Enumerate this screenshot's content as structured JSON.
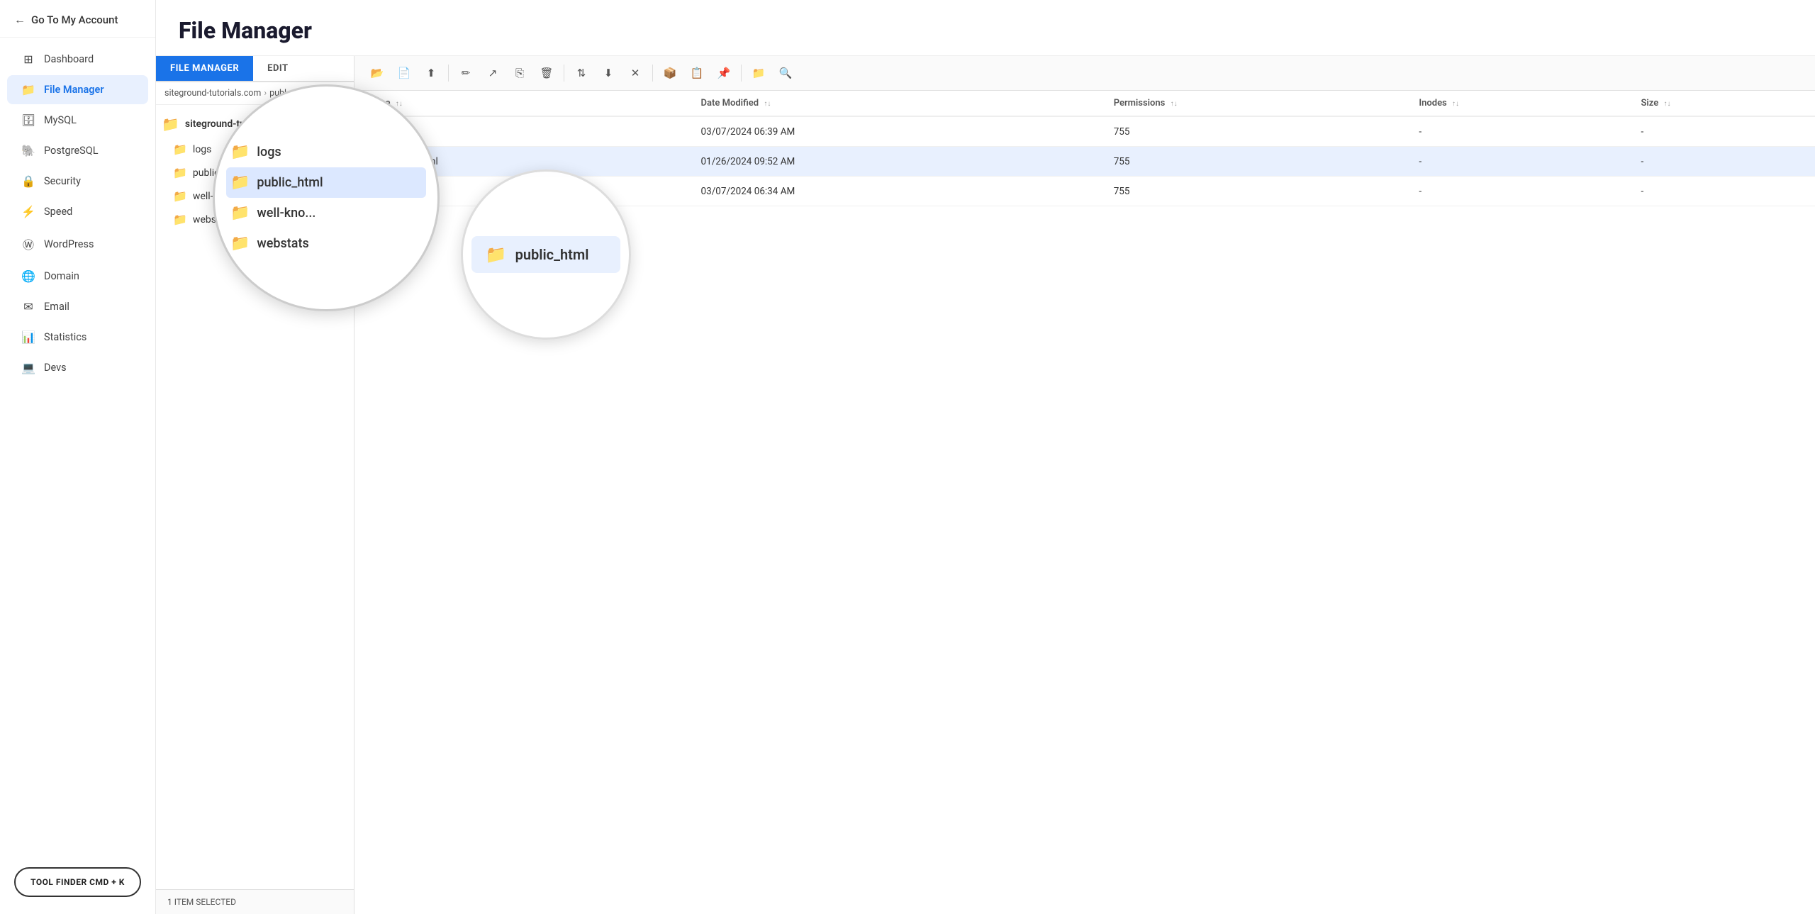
{
  "sidebar": {
    "back_label": "Go To My Account",
    "nav_items": [
      {
        "id": "dashboard",
        "label": "Dashboard",
        "icon": "⊞"
      },
      {
        "id": "file-manager",
        "label": "File Manager",
        "icon": "📁",
        "active": true
      },
      {
        "id": "mysql",
        "label": "MySQL",
        "icon": "🗄"
      },
      {
        "id": "postgresql",
        "label": "PostgreSQL",
        "icon": "🐘"
      },
      {
        "id": "security",
        "label": "Security",
        "icon": "🔒"
      },
      {
        "id": "speed",
        "label": "Speed",
        "icon": "⚡"
      },
      {
        "id": "wordpress",
        "label": "WordPress",
        "icon": "Ⓦ"
      },
      {
        "id": "domain",
        "label": "Domain",
        "icon": "🌐"
      },
      {
        "id": "email",
        "label": "Email",
        "icon": "✉"
      },
      {
        "id": "statistics",
        "label": "Statistics",
        "icon": "📊"
      },
      {
        "id": "devs",
        "label": "Devs",
        "icon": "💻"
      }
    ],
    "tool_finder_label": "TOOL FINDER CMD + K"
  },
  "page": {
    "title": "File Manager"
  },
  "tabs": [
    {
      "id": "file-manager-tab",
      "label": "FILE MANAGER",
      "active": true
    },
    {
      "id": "edit-tab",
      "label": "EDIT",
      "active": false
    }
  ],
  "breadcrumb": {
    "parts": [
      "siteground-tutorials.com",
      "publ..."
    ]
  },
  "folder_tree": {
    "root": "siteground-tutorials.com",
    "children": [
      {
        "name": "logs",
        "has_children": false
      },
      {
        "name": "public_html",
        "has_children": true,
        "expanded": true
      },
      {
        "name": "well-know...",
        "has_children": false
      },
      {
        "name": "webstats",
        "has_children": false
      }
    ]
  },
  "toolbar_buttons": [
    {
      "id": "new-folder",
      "icon": "📂",
      "tooltip": "New Folder"
    },
    {
      "id": "new-file",
      "icon": "📄",
      "tooltip": "New File"
    },
    {
      "id": "upload",
      "icon": "⬆",
      "tooltip": "Upload"
    },
    {
      "id": "edit-file",
      "icon": "✏",
      "tooltip": "Edit"
    },
    {
      "id": "move",
      "icon": "↗",
      "tooltip": "Move"
    },
    {
      "id": "copy",
      "icon": "⎘",
      "tooltip": "Copy"
    },
    {
      "id": "delete",
      "icon": "🗑",
      "tooltip": "Delete"
    },
    {
      "id": "move2",
      "icon": "⇕",
      "tooltip": "Move"
    },
    {
      "id": "download",
      "icon": "⬇",
      "tooltip": "Download"
    },
    {
      "id": "delete2",
      "icon": "✕",
      "tooltip": "Delete"
    },
    {
      "id": "archive",
      "icon": "📦",
      "tooltip": "Archive"
    },
    {
      "id": "copy2",
      "icon": "📋",
      "tooltip": "Copy"
    },
    {
      "id": "pin",
      "icon": "📌",
      "tooltip": "Pin"
    },
    {
      "id": "folder-new",
      "icon": "🗀",
      "tooltip": "New Folder"
    },
    {
      "id": "search",
      "icon": "🔍",
      "tooltip": "Search"
    }
  ],
  "file_table": {
    "columns": [
      {
        "id": "name",
        "label": "Name"
      },
      {
        "id": "date_modified",
        "label": "Date Modified"
      },
      {
        "id": "permissions",
        "label": "Permissions"
      },
      {
        "id": "inodes",
        "label": "Inodes"
      },
      {
        "id": "size",
        "label": "Size"
      }
    ],
    "rows": [
      {
        "id": "logs",
        "name": "logs",
        "date_modified": "03/07/2024 06:39 AM",
        "permissions": "755",
        "inodes": "-",
        "size": "-",
        "selected": false,
        "icon": "folder-gray"
      },
      {
        "id": "public_html",
        "name": "public_html",
        "date_modified": "01/26/2024 09:52 AM",
        "permissions": "755",
        "inodes": "-",
        "size": "-",
        "selected": true,
        "icon": "folder-gray"
      },
      {
        "id": "webstats",
        "name": "webstats",
        "date_modified": "03/07/2024 06:34 AM",
        "permissions": "755",
        "inodes": "-",
        "size": "-",
        "selected": false,
        "icon": "folder-gray"
      }
    ]
  },
  "status_bar": {
    "text": "1 ITEM SELECTED"
  },
  "magnifier": {
    "zoom_items": [
      {
        "name": "logs",
        "type": "folder-blue"
      },
      {
        "name": "public_html",
        "type": "folder-gray",
        "selected": true
      },
      {
        "name": "well-kno...",
        "type": "folder-gray"
      },
      {
        "name": "webstats",
        "type": "folder-gray"
      }
    ],
    "zoom2_label": "public_html"
  }
}
